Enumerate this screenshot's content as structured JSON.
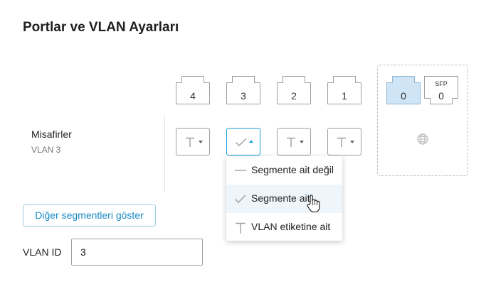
{
  "page": {
    "title": "Portlar ve VLAN Ayarları"
  },
  "ports": [
    {
      "label": "4"
    },
    {
      "label": "3"
    },
    {
      "label": "2"
    },
    {
      "label": "1"
    }
  ],
  "wan": {
    "port_label": "0",
    "sfp_caption": "SFP",
    "sfp_label": "0",
    "icon": "globe-icon"
  },
  "segment": {
    "name": "Misafirler",
    "sub": "VLAN 3"
  },
  "port_states": [
    "tagged",
    "untagged",
    "tagged",
    "tagged"
  ],
  "dropdown": {
    "items": [
      {
        "label": "Segmente ait değil",
        "icon": "dash-icon"
      },
      {
        "label": "Segmente ait",
        "icon": "check-icon"
      },
      {
        "label": "VLAN etiketine ait",
        "icon": "tag-t-icon"
      }
    ]
  },
  "actions": {
    "show_other_segments": "Diğer segmentleri göster"
  },
  "vlan": {
    "label": "VLAN ID",
    "value": "3"
  },
  "colors": {
    "accent": "#1a9fd6",
    "active_port": "#cfe5f6"
  }
}
